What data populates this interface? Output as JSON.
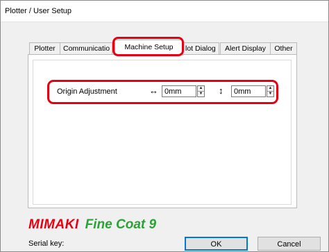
{
  "window": {
    "title": "Plotter / User Setup"
  },
  "tabs": [
    {
      "label": "Plotter"
    },
    {
      "label": "Communicatio"
    },
    {
      "label": "Machine Setup"
    },
    {
      "label": "lot Dialog"
    },
    {
      "label": "Alert Display"
    },
    {
      "label": "Other"
    }
  ],
  "active_tab": "Machine Setup",
  "origin_adjustment": {
    "label": "Origin Adjustment",
    "horizontal_symbol": "↔",
    "vertical_symbol": "↕",
    "x_value": "0mm",
    "y_value": "0mm"
  },
  "logo": {
    "brand": "MIMAKI",
    "product": "Fine Coat 9"
  },
  "serial_key": {
    "label": "Serial key:"
  },
  "buttons": {
    "ok": "OK",
    "cancel": "Cancel"
  },
  "colors": {
    "highlight": "#e60012",
    "brand_red": "#e60012",
    "product_green": "#2aa236",
    "focus_blue": "#0078d7"
  }
}
